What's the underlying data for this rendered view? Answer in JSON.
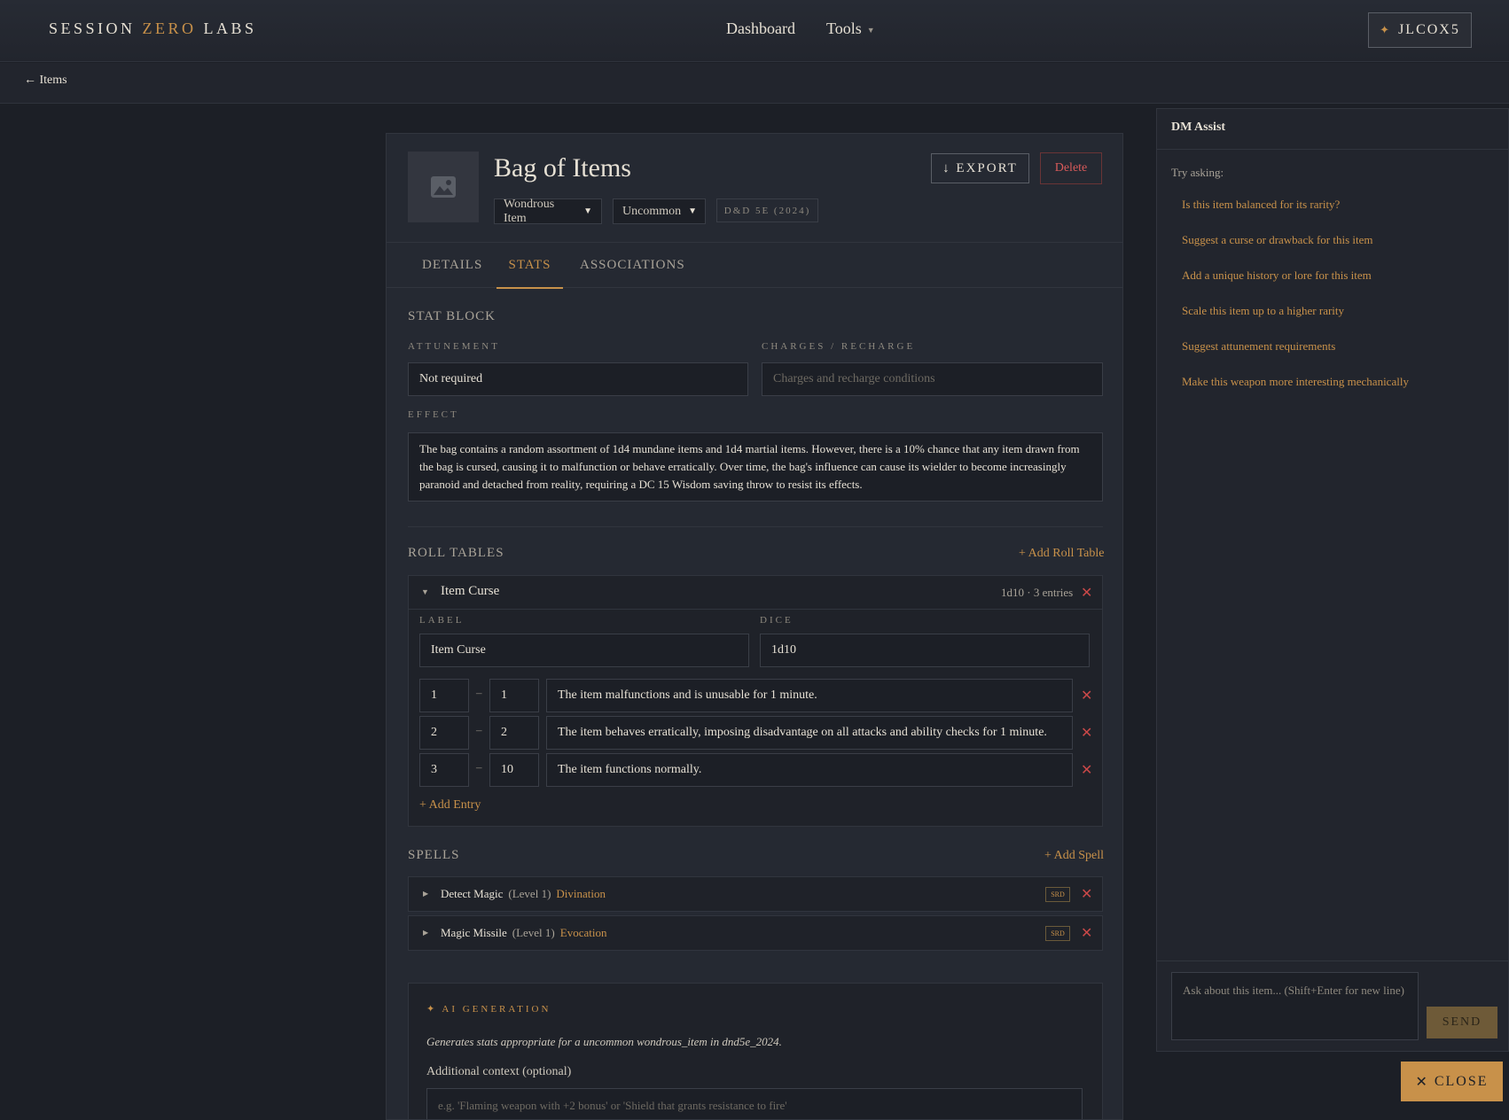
{
  "brand": {
    "part1": "SESSION ",
    "part2": "ZERO",
    "part3": " LABS"
  },
  "nav": {
    "dashboard": "Dashboard",
    "tools": "Tools",
    "user": "JLCOX5"
  },
  "breadcrumb": {
    "back": "← Items"
  },
  "item": {
    "title": "Bag of Items",
    "type": "Wondrous Item",
    "rarity": "Uncommon",
    "edition": "D&D 5E (2024)",
    "export_label": "↓ EXPORT",
    "delete_label": "Delete"
  },
  "tabs": [
    "DETAILS",
    "STATS",
    "ASSOCIATIONS"
  ],
  "stat_block": {
    "title": "STAT BLOCK",
    "attunement_label": "ATTUNEMENT",
    "attunement_value": "Not required",
    "charges_label": "CHARGES / RECHARGE",
    "charges_placeholder": "Charges and recharge conditions",
    "effect_label": "EFFECT",
    "effect_value": "The bag contains a random assortment of 1d4 mundane items and 1d4 martial items. However, there is a 10% chance that any item drawn from the bag is cursed, causing it to malfunction or behave erratically. Over time, the bag's influence can cause its wielder to become increasingly paranoid and detached from reality, requiring a DC 15 Wisdom saving throw to resist its effects."
  },
  "roll_tables": {
    "title": "ROLL TABLES",
    "add_label": "+ Add Roll Table",
    "table": {
      "name": "Item Curse",
      "meta": "1d10 · 3 entries",
      "label_label": "LABEL",
      "label_value": "Item Curse",
      "dice_label": "DICE",
      "dice_value": "1d10",
      "entries": [
        {
          "min": "1",
          "max": "1",
          "text": "The item malfunctions and is unusable for 1 minute."
        },
        {
          "min": "2",
          "max": "2",
          "text": "The item behaves erratically, imposing disadvantage on all attacks and ability checks for 1 minute."
        },
        {
          "min": "3",
          "max": "10",
          "text": "The item functions normally."
        }
      ],
      "add_entry": "+ Add Entry"
    }
  },
  "spells": {
    "title": "SPELLS",
    "add_label": "+ Add Spell",
    "items": [
      {
        "name": "Detect Magic",
        "level": "(Level 1)",
        "school": "Divination",
        "badge": "SRD"
      },
      {
        "name": "Magic Missile",
        "level": "(Level 1)",
        "school": "Evocation",
        "badge": "SRD"
      }
    ]
  },
  "ai_generation": {
    "title": "AI GENERATION",
    "description": "Generates stats appropriate for a uncommon wondrous_item in dnd5e_2024.",
    "context_label": "Additional context (optional)",
    "context_placeholder": "e.g. 'Flaming weapon with +2 bonus' or 'Shield that grants resistance to fire'"
  },
  "dm_assist": {
    "title": "DM Assist",
    "try_label": "Try asking:",
    "suggestions": [
      "Is this item balanced for its rarity?",
      "Suggest a curse or drawback for this item",
      "Add a unique history or lore for this item",
      "Scale this item up to a higher rarity",
      "Suggest attunement requirements",
      "Make this weapon more interesting mechanically"
    ],
    "input_placeholder": "Ask about this item... (Shift+Enter for new line)",
    "send_label": "SEND"
  },
  "close_label": "CLOSE",
  "colors": {
    "accent": "#c8914a",
    "danger": "#c84848",
    "background": "#1c1f26"
  }
}
